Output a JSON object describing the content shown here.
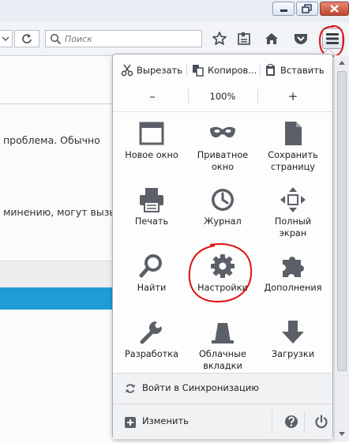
{
  "toolbar": {
    "search_placeholder": "Поиск"
  },
  "page": {
    "lines": [
      "проблема. Обычно",
      "минению, могут вызыв"
    ]
  },
  "panel": {
    "edit": {
      "cut": "Вырезать",
      "copy": "Копиров...",
      "paste": "Вставить"
    },
    "zoom": {
      "minus": "–",
      "value": "100%",
      "plus": "+"
    },
    "items": [
      {
        "label": "Новое окно",
        "icon": "window-icon"
      },
      {
        "label": "Приватное окно",
        "icon": "mask-icon"
      },
      {
        "label": "Сохранить страницу",
        "icon": "page-icon"
      },
      {
        "label": "Печать",
        "icon": "printer-icon"
      },
      {
        "label": "Журнал",
        "icon": "clock-icon"
      },
      {
        "label": "Полный экран",
        "icon": "fullscreen-icon"
      },
      {
        "label": "Найти",
        "icon": "magnifier-icon"
      },
      {
        "label": "Настройки",
        "icon": "gear-icon"
      },
      {
        "label": "Дополнения",
        "icon": "puzzle-icon"
      },
      {
        "label": "Разработка",
        "icon": "wrench-icon"
      },
      {
        "label": "Облачные вкладки",
        "icon": "cloud-tabs-icon"
      },
      {
        "label": "Загрузки",
        "icon": "download-arrow-icon"
      }
    ],
    "sync_label": "Войти в Синхронизацию",
    "customize_label": "Изменить"
  },
  "colors": {
    "annotation_red": "#e01010",
    "accent_blue": "#1d9cd6",
    "icon_gray": "#5b6068"
  }
}
